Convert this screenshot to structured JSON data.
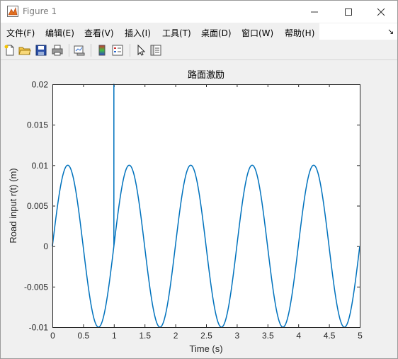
{
  "window": {
    "title": "Figure 1",
    "menu": [
      "文件(F)",
      "编辑(E)",
      "查看(V)",
      "插入(I)",
      "工具(T)",
      "桌面(D)",
      "窗口(W)",
      "帮助(H)"
    ],
    "toolbar_icons": [
      "new-figure-icon",
      "open-file-icon",
      "save-icon",
      "print-icon",
      "link-plot-icon",
      "insert-colorbar-icon",
      "insert-legend-icon",
      "edit-plot-arrow-icon",
      "property-inspector-icon"
    ]
  },
  "chart_data": {
    "type": "line",
    "title": "路面激励",
    "xlabel": "Time (s)",
    "ylabel": "Road input r(t) (m)",
    "xlim": [
      0,
      5
    ],
    "ylim": [
      -0.01,
      0.02
    ],
    "xticks": [
      "0",
      "0.5",
      "1",
      "1.5",
      "2",
      "2.5",
      "3",
      "3.5",
      "4",
      "4.5",
      "5"
    ],
    "yticks": [
      "-0.01",
      "-0.005",
      "0",
      "0.005",
      "0.01",
      "0.015",
      "0.02"
    ],
    "series": [
      {
        "color": "#0072bd",
        "function": "r(t) = 0.01*sin(2*pi*t), with a spike to 0.02 at t = 1",
        "x": [
          0,
          0.25,
          0.5,
          0.75,
          1.0,
          1.0,
          1.0,
          1.25,
          1.5,
          1.75,
          2.0,
          2.25,
          2.5,
          2.75,
          3.0,
          3.25,
          3.5,
          3.75,
          4.0,
          4.25,
          4.5,
          4.75,
          5.0
        ],
        "y": [
          0,
          0.01,
          0,
          -0.01,
          0,
          0.02,
          0,
          0.01,
          0,
          -0.01,
          0,
          0.01,
          0,
          -0.01,
          0,
          0.01,
          0,
          -0.01,
          0,
          0.01,
          0,
          -0.01,
          0
        ]
      }
    ]
  }
}
